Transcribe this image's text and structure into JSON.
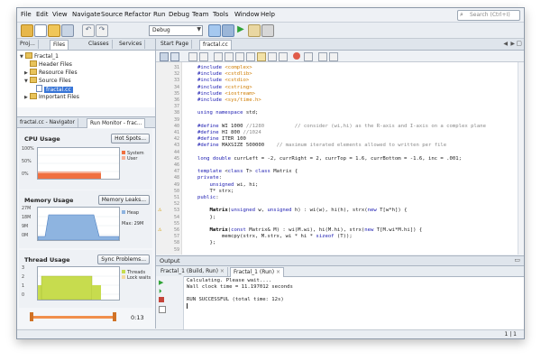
{
  "menu": [
    "File",
    "Edit",
    "View",
    "Navigate",
    "Source",
    "Refactor",
    "Run",
    "Debug",
    "Team",
    "Tools",
    "Window",
    "Help"
  ],
  "search": {
    "placeholder": "Search (Ctrl+I)"
  },
  "toolbar": {
    "config_value": "Debug"
  },
  "left_tabs": [
    "Proj...",
    "Files",
    "Classes",
    "Services"
  ],
  "tree": [
    {
      "label": "Fractal_1",
      "indent": 0,
      "type": "project"
    },
    {
      "label": "Header Files",
      "indent": 1,
      "type": "folder"
    },
    {
      "label": "Resource Files",
      "indent": 1,
      "type": "folder"
    },
    {
      "label": "Source Files",
      "indent": 1,
      "type": "folder"
    },
    {
      "label": "fractal.cc",
      "indent": 2,
      "type": "file",
      "selected": true
    },
    {
      "label": "Important Files",
      "indent": 1,
      "type": "folder"
    }
  ],
  "nav_tabs": {
    "navigator": "fractal.cc - Navigator",
    "monitor": "Run Monitor - frac..."
  },
  "cpu": {
    "title": "CPU Usage",
    "button": "Hot Spots...",
    "legend": [
      "System",
      "User"
    ],
    "y_labels": [
      "100%",
      "50%",
      "0%"
    ],
    "colors": {
      "system": "#f07040",
      "user": "#f6b097"
    }
  },
  "memory": {
    "title": "Memory Usage",
    "button": "Memory Leaks...",
    "legend": [
      "Heap",
      "Max: 29M"
    ],
    "y_labels": [
      "27M",
      "18M",
      "9M",
      "0M"
    ],
    "color": "#8eb4e0"
  },
  "threads": {
    "title": "Thread Usage",
    "button": "Sync Problems...",
    "legend": [
      "Threads",
      "Lock waits"
    ],
    "y_labels": [
      "3",
      "2",
      "1",
      "0"
    ],
    "color": "#c7dc4e"
  },
  "timeline": {
    "time": "0:13"
  },
  "editor": {
    "tabs": [
      "Start Page",
      "fractal.cc"
    ],
    "lines": [
      {
        "n": "31",
        "html": "<span class='kw'>#include</span> <span class='str'>&lt;complex&gt;</span>"
      },
      {
        "n": "32",
        "html": "<span class='kw'>#include</span> <span class='str'>&lt;cstdlib&gt;</span>"
      },
      {
        "n": "33",
        "html": "<span class='kw'>#include</span> <span class='str'>&lt;cstdio&gt;</span>"
      },
      {
        "n": "34",
        "html": "<span class='kw'>#include</span> <span class='str'>&lt;cstring&gt;</span>"
      },
      {
        "n": "35",
        "html": "<span class='kw'>#include</span> <span class='str'>&lt;iostream&gt;</span>"
      },
      {
        "n": "36",
        "html": "<span class='kw'>#include</span> <span class='str'>&lt;sys/time.h&gt;</span>"
      },
      {
        "n": "37",
        "html": ""
      },
      {
        "n": "38",
        "html": "<span class='kw'>using namespace</span> std;"
      },
      {
        "n": "39",
        "html": ""
      },
      {
        "n": "40",
        "html": "<span class='kw'>#define</span> WI 1000 <span class='cm'>//1280          // consider (wi,hi) as the R-axis and I-axis on a complex plane</span>"
      },
      {
        "n": "41",
        "html": "<span class='kw'>#define</span> HI 800 <span class='cm'>//1024</span>"
      },
      {
        "n": "42",
        "html": "<span class='kw'>#define</span> ITER 100"
      },
      {
        "n": "43",
        "html": "<span class='kw'>#define</span> MAXSIZE 500000    <span class='cm'>// maximum iterated elements allowed to written per file</span>"
      },
      {
        "n": "44",
        "html": ""
      },
      {
        "n": "45",
        "html": "<span class='kw'>long double</span> currLeft = -2, currRight = 2, currTop = 1.6, currBottom = -1.6, inc = .001;"
      },
      {
        "n": "46",
        "html": ""
      },
      {
        "n": "47",
        "html": "<span class='kw'>template</span> &lt;<span class='kw'>class</span> T&gt; <span class='kw'>class</span> Matrix {"
      },
      {
        "n": "48",
        "html": "<span class='kw'>private</span>:"
      },
      {
        "n": "49",
        "html": "    <span class='kw'>unsigned</span> wi, hi;"
      },
      {
        "n": "50",
        "html": "    T* strx;"
      },
      {
        "n": "51",
        "html": "<span class='kw'>public</span>:"
      },
      {
        "n": "52",
        "html": ""
      },
      {
        "n": "53",
        "html": "    <span class='fn'>Matrix</span>(<span class='kw'>unsigned</span> w, <span class='kw'>unsigned</span> h) : wi(w), hi(h), strx(<span class='kw'>new</span> T[w*h]) {"
      },
      {
        "n": "54",
        "html": "    };"
      },
      {
        "n": "55",
        "html": ""
      },
      {
        "n": "56",
        "html": "    <span class='fn'>Matrix</span>(<span class='kw'>const</span> Matrix&amp; M) : wi(M.wi), hi(M.hi), strx(<span class='kw'>new</span> T[M.wi*M.hi]) {"
      },
      {
        "n": "57",
        "html": "        memcpy(strx, M.strx, wi * hi * <span class='kw'>sizeof</span> (T));"
      },
      {
        "n": "58",
        "html": "    };"
      },
      {
        "n": "59",
        "html": ""
      }
    ]
  },
  "output": {
    "title": "Output",
    "tabs": [
      "Fractal_1 (Build, Run)",
      "Fractal_1 (Run)"
    ],
    "lines": [
      "Calculating. Please wait....",
      "Wall clock time = 11.197012 seconds",
      "",
      "RUN SUCCESSFUL (total time: 12s)"
    ]
  },
  "status": {
    "position": "1 | 1"
  }
}
